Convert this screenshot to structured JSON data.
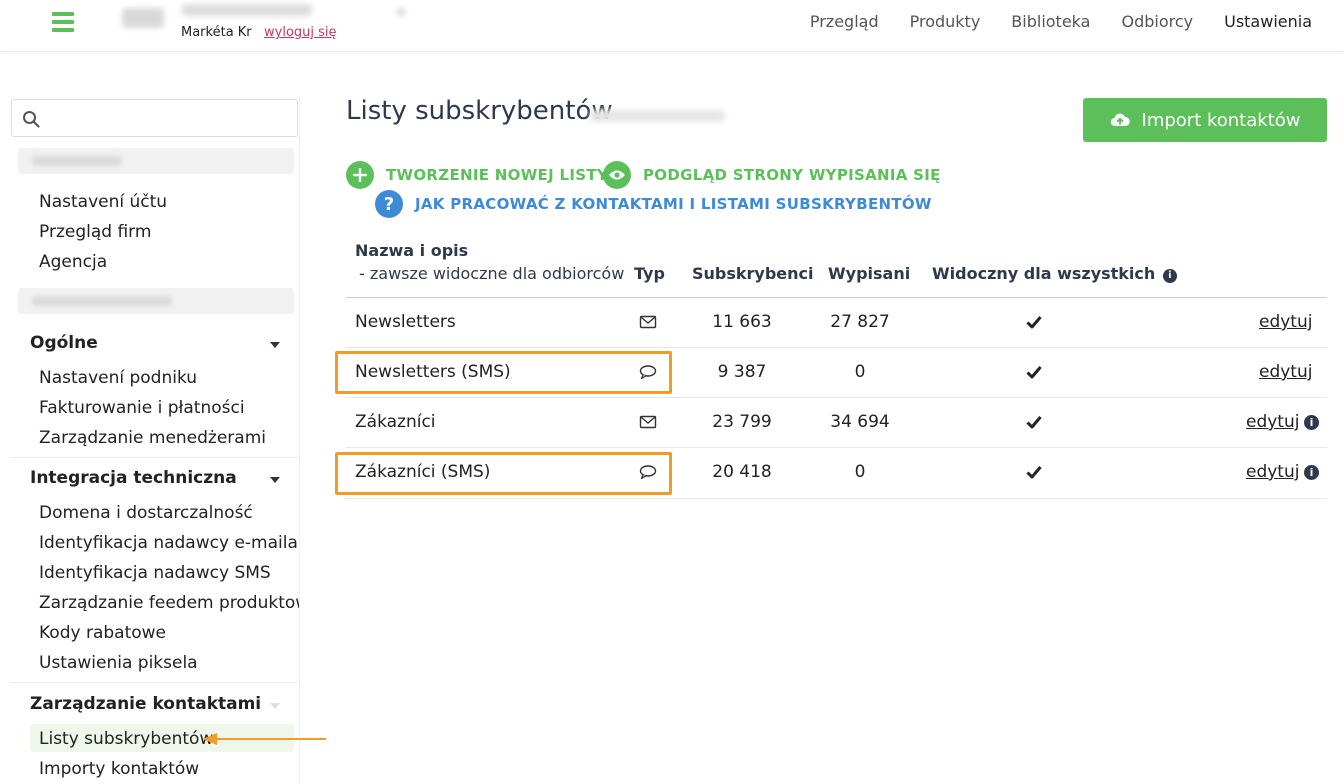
{
  "header": {
    "user_name": "Markéta Kr",
    "logout_label": "wyloguj się",
    "nav": [
      "Przegląd",
      "Produkty",
      "Biblioteka",
      "Odbiorcy",
      "Ustawienia"
    ],
    "active_nav": "Ustawienia"
  },
  "sidebar": {
    "search_placeholder": "",
    "account_items": [
      "Nastavení účtu",
      "Przegląd firm",
      "Agencja"
    ],
    "general": {
      "title": "Ogólne",
      "items": [
        "Nastavení podniku",
        "Fakturowanie i płatności",
        "Zarządzanie menedżerami"
      ]
    },
    "integration": {
      "title": "Integracja techniczna",
      "items": [
        "Domena i dostarczalność",
        "Identyfikacja nadawcy e-maila",
        "Identyfikacja nadawcy SMS",
        "Zarządzanie feedem produktowym",
        "Kody rabatowe",
        "Ustawienia piksela"
      ]
    },
    "contacts": {
      "title": "Zarządzanie kontaktami",
      "items": [
        "Listy subskrybentów",
        "Importy kontaktów"
      ],
      "active_item": "Listy subskrybentów"
    }
  },
  "main": {
    "title": "Listy subskrybentów",
    "import_button": "Import kontaktów",
    "actions": {
      "new_list": "TWORZENIE NOWEJ LISTY",
      "preview": "PODGLĄD STRONY WYPISANIA SIĘ",
      "help": "JAK PRACOWAĆ Z KONTAKTAMI I LISTAMI SUBSKRYBENTÓW"
    },
    "table": {
      "headers": {
        "name": "Nazwa i opis",
        "name_sub": "- zawsze widoczne dla odbiorców",
        "type": "Typ",
        "subscribers": "Subskrybenci",
        "unsubscribed": "Wypisani",
        "visible": "Widoczny dla wszystkich"
      },
      "rows": [
        {
          "name": "Newsletters",
          "type": "email-icon",
          "subscribers": "11 663",
          "unsubscribed": "27 827",
          "visible": true,
          "edit": "edytuj",
          "info": false
        },
        {
          "name": "Newsletters (SMS)",
          "type": "sms-icon",
          "subscribers": "9 387",
          "unsubscribed": "0",
          "visible": true,
          "edit": "edytuj",
          "info": false
        },
        {
          "name": "Zákazníci",
          "type": "email-icon",
          "subscribers": "23 799",
          "unsubscribed": "34 694",
          "visible": true,
          "edit": "edytuj",
          "info": true
        },
        {
          "name": "Zákazníci (SMS)",
          "type": "sms-icon",
          "subscribers": "20 418",
          "unsubscribed": "0",
          "visible": true,
          "edit": "edytuj",
          "info": true
        }
      ]
    }
  },
  "colors": {
    "accent_green": "#5cbf5a",
    "accent_blue": "#3d8bd6",
    "highlight_orange": "#f29b25",
    "link_red": "#c4395f"
  }
}
